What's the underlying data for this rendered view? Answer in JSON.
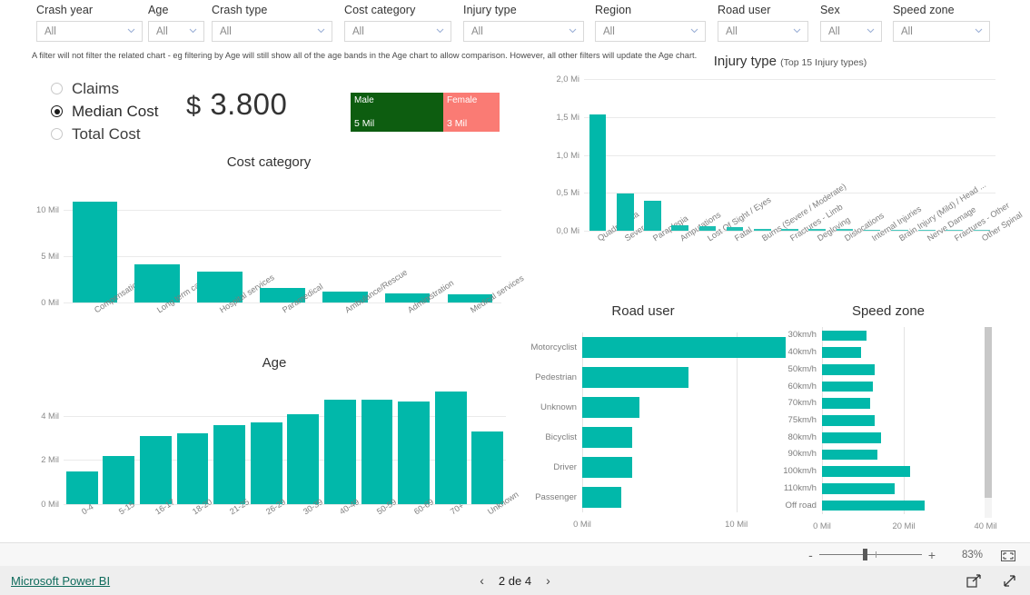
{
  "filters": [
    {
      "label": "Crash year",
      "value": "All",
      "left": 40,
      "width": 117
    },
    {
      "label": "Age",
      "value": "All",
      "left": 163,
      "width": 62
    },
    {
      "label": "Crash type",
      "value": "All",
      "left": 233,
      "width": 133
    },
    {
      "label": "Cost category",
      "value": "All",
      "left": 379,
      "width": 118
    },
    {
      "label": "Injury type",
      "value": "All",
      "left": 510,
      "width": 133
    },
    {
      "label": "Region",
      "value": "All",
      "left": 655,
      "width": 122
    },
    {
      "label": "Road user",
      "value": "All",
      "left": 790,
      "width": 100
    },
    {
      "label": "Sex",
      "value": "All",
      "left": 903,
      "width": 68
    },
    {
      "label": "Speed zone",
      "value": "All",
      "left": 983,
      "width": 107
    }
  ],
  "filter_note": "A filter will not filter the related chart - eg filtering by Age will still show all of the age bands in the Age chart to allow comparison. However, all other filters will update the Age chart.",
  "measure_selector": {
    "options": [
      {
        "label": "Claims",
        "selected": false
      },
      {
        "label": "Median Cost",
        "selected": true
      },
      {
        "label": "Total Cost",
        "selected": false
      }
    ]
  },
  "kpi": {
    "currency": "$",
    "value": "3.800"
  },
  "gender_tiles": [
    {
      "name": "Male",
      "value": "5 Mil",
      "color": "#0d5d10"
    },
    {
      "name": "Female",
      "value": "3 Mil",
      "color": "#fa7b74"
    }
  ],
  "colors": {
    "bar": "#01b8aa",
    "male": "#0d5d10",
    "female": "#fa7b74",
    "brand": "#0f6b5c"
  },
  "status_bar": {
    "zoom_percent": "83%",
    "minus": "-",
    "plus": "+",
    "fit_icon": "fit-to-page-icon"
  },
  "footer": {
    "brand": "Microsoft Power BI",
    "page_text": "2 de 4",
    "prev_arrow": "‹",
    "next_arrow": "›",
    "share_icon": "share-icon",
    "fullscreen_icon": "fullscreen-icon"
  },
  "chart_data": [
    {
      "id": "cost_category",
      "type": "bar",
      "title": "Cost category",
      "xlabel": "",
      "ylabel": "",
      "ylim": [
        0,
        12
      ],
      "yticks": [
        0,
        5,
        10
      ],
      "ytick_labels": [
        "0 Mil",
        "5 Mil",
        "10 Mil"
      ],
      "grid": true,
      "categories": [
        "Compensation",
        "Long term care",
        "Hospital services",
        "Paramedical",
        "Ambulance/Rescue",
        "Administration",
        "Medical services"
      ],
      "values": [
        10.8,
        4.1,
        3.3,
        1.6,
        1.2,
        1.0,
        0.9
      ]
    },
    {
      "id": "age",
      "type": "bar",
      "title": "Age",
      "xlabel": "",
      "ylabel": "",
      "ylim": [
        0,
        5.4
      ],
      "yticks": [
        0,
        2,
        4
      ],
      "ytick_labels": [
        "0 Mil",
        "2 Mil",
        "4 Mil"
      ],
      "grid": true,
      "categories": [
        "0-4",
        "5-15",
        "16-17",
        "18-20",
        "21-25",
        "26-29",
        "30-39",
        "40-49",
        "50-59",
        "60-69",
        "70+",
        "Unknown"
      ],
      "values": [
        1.5,
        2.2,
        3.1,
        3.2,
        3.6,
        3.7,
        4.1,
        4.75,
        4.75,
        4.65,
        5.1,
        3.3
      ]
    },
    {
      "id": "injury_type",
      "type": "bar",
      "title": "Injury type",
      "subtitle": "(Top 15 Injury types)",
      "xlabel": "",
      "ylabel": "",
      "ylim": [
        0,
        2.0
      ],
      "yticks": [
        0,
        0.5,
        1.0,
        1.5,
        2.0
      ],
      "ytick_labels": [
        "0,0 Mi",
        "0,5 Mi",
        "1,0 Mi",
        "1,5 Mi",
        "2,0 Mi"
      ],
      "grid": true,
      "categories": [
        "Quadriplegia",
        "Severe ABI",
        "Paraplegia",
        "Amputations",
        "Lost Of Sight / Eyes",
        "Fatal",
        "Burns (Severe / Moderate)",
        "Fractures - Limb",
        "Degloving",
        "Dislocations",
        "Internal Injuries",
        "Brain Injury (Mild) / Head ...",
        "Nerve Damage",
        "Fractures - Other",
        "Other Spinal"
      ],
      "values": [
        1.53,
        0.49,
        0.4,
        0.07,
        0.055,
        0.042,
        0.026,
        0.022,
        0.02,
        0.018,
        0.016,
        0.014,
        0.012,
        0.011,
        0.01
      ]
    },
    {
      "id": "road_user",
      "type": "bar",
      "orientation": "horizontal",
      "title": "Road user",
      "xlabel": "",
      "ylabel": "",
      "xlim": [
        0,
        16.5
      ],
      "xticks": [
        0,
        10
      ],
      "xtick_labels": [
        "0 Mil",
        "10 Mil"
      ],
      "grid": true,
      "categories": [
        "Motorcyclist",
        "Pedestrian",
        "Unknown",
        "Bicyclist",
        "Driver",
        "Passenger"
      ],
      "values": [
        13.2,
        6.9,
        3.7,
        3.25,
        3.25,
        2.55
      ]
    },
    {
      "id": "speed_zone",
      "type": "bar",
      "orientation": "horizontal",
      "title": "Speed zone",
      "xlabel": "",
      "ylabel": "",
      "xlim": [
        0,
        44
      ],
      "xticks": [
        0,
        20,
        40
      ],
      "xtick_labels": [
        "0 Mil",
        "20 Mil",
        "40 Mil"
      ],
      "grid": true,
      "categories": [
        "30km/h",
        "40km/h",
        "50km/h",
        "60km/h",
        "70km/h",
        "75km/h",
        "80km/h",
        "90km/h",
        "100km/h",
        "110km/h",
        "Off road"
      ],
      "values": [
        10.8,
        9.5,
        12.9,
        12.4,
        11.8,
        12.9,
        14.4,
        13.6,
        21.5,
        17.8,
        25.2
      ],
      "has_scrollbar": true
    }
  ]
}
